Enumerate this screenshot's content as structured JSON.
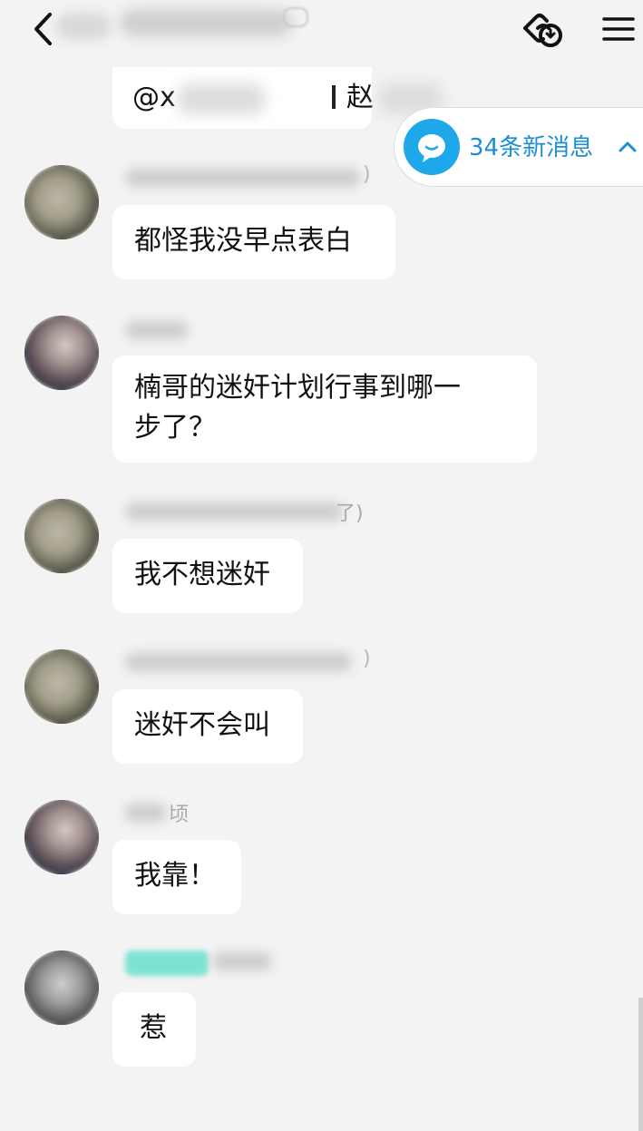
{
  "header": {
    "back_icon": "chevron-left-icon",
    "link_icon": "link-icon",
    "menu_icon": "menu-icon"
  },
  "partial_message": {
    "mention_prefix": "@x",
    "mention_char": "赵"
  },
  "new_messages": {
    "label": "34条新消息",
    "icon": "chat-bubble-icon",
    "chevron": "chevron-up-icon",
    "accent": "#1ea8ea"
  },
  "messages": [
    {
      "sender_suffix": ")",
      "text": "都怪我没早点表白"
    },
    {
      "sender_suffix": "",
      "text_line1": "楠哥的迷奸计划行事到哪一",
      "text_line2": "步了？"
    },
    {
      "sender_suffix": "了)",
      "text": "我不想迷奸"
    },
    {
      "sender_suffix": ")",
      "text": "迷奸不会叫"
    },
    {
      "sender_suffix": "顷",
      "text": "我靠！"
    },
    {
      "sender_suffix": "",
      "text": "惹"
    }
  ],
  "colors": {
    "background": "#f3f3f3",
    "bubble": "#ffffff",
    "accent_text": "#1b8fd1",
    "highlight_name": "#7ee2d3"
  }
}
